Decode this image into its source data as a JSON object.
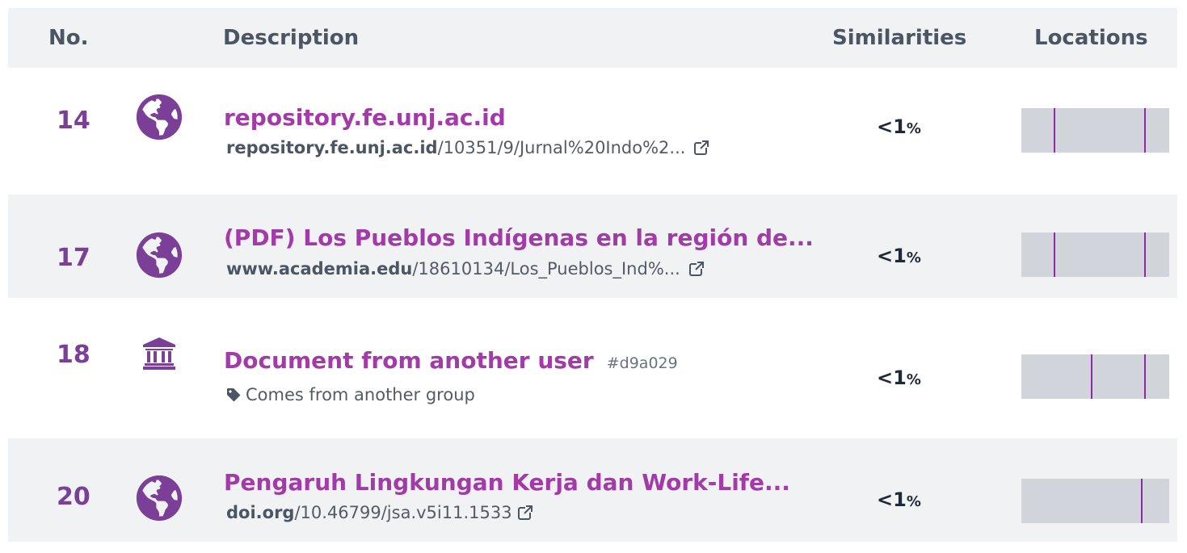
{
  "header": {
    "no": "No.",
    "description": "Description",
    "similarities": "Similarities",
    "locations": "Locations"
  },
  "rows": [
    {
      "number": "14",
      "icon": "globe-icon",
      "title": "repository.fe.unj.ac.id",
      "url_domain": "repository.fe.unj.ac.id",
      "url_path": "/10351/9/Jurnal%20Indo%2...",
      "similarity": "<1",
      "similarity_unit": "%",
      "locations": [
        0.22,
        0.83
      ]
    },
    {
      "number": "17",
      "icon": "globe-icon",
      "title": "(PDF) Los Pueblos Indígenas en la región de...",
      "url_domain": "www.academia.edu",
      "url_path": "/18610134/Los_Pueblos_Ind%...",
      "similarity": "<1",
      "similarity_unit": "%",
      "locations": [
        0.22,
        0.83
      ]
    },
    {
      "number": "18",
      "icon": "bank-icon",
      "title": "Document from another user",
      "tag": "#d9a029",
      "subtitle": "Comes from another group",
      "similarity": "<1",
      "similarity_unit": "%",
      "locations": [
        0.47,
        0.83
      ]
    },
    {
      "number": "20",
      "icon": "globe-icon",
      "title": "Pengaruh Lingkungan Kerja dan Work-Life...",
      "url_domain": "doi.org",
      "url_path": "/10.46799/jsa.v5i11.1533",
      "similarity": "<1",
      "similarity_unit": "%",
      "locations": [
        0.81
      ]
    }
  ],
  "colors": {
    "accent": "#a23aa8",
    "number": "#7b3f98",
    "location_mark": "#8e2aa3",
    "location_bar": "#d1d5db",
    "row_alt": "#f1f2f4"
  }
}
